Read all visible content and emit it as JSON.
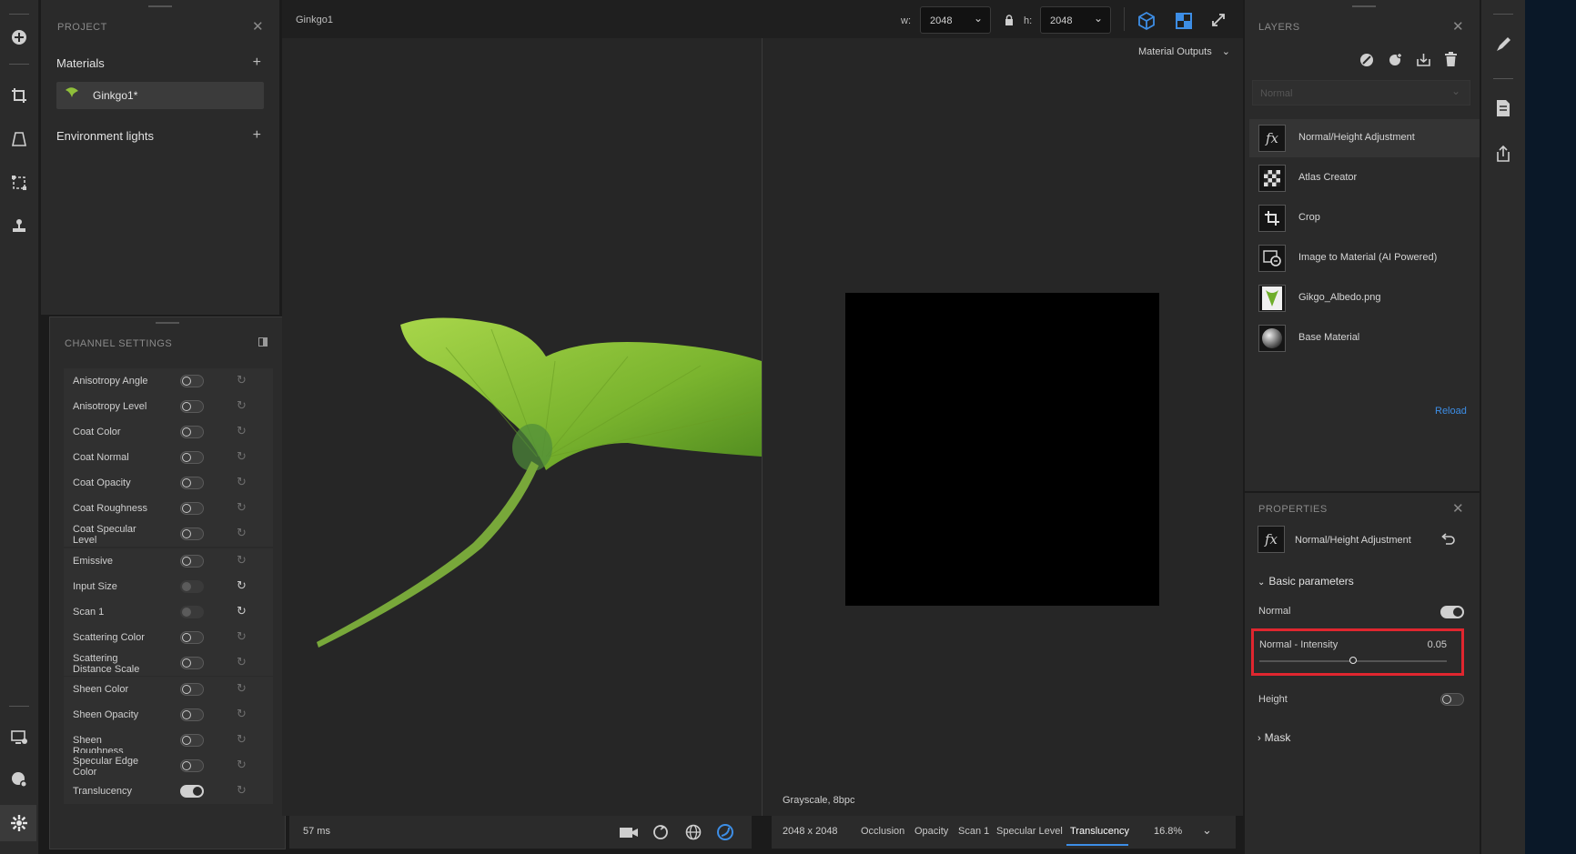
{
  "left_toolbar": {
    "icons": [
      "add-circle-icon",
      "crop-icon",
      "perspective-icon",
      "transform-icon",
      "stamp-icon",
      "display-settings-icon",
      "environment-settings-icon",
      "channel-settings-icon"
    ]
  },
  "project": {
    "title": "PROJECT",
    "materials_label": "Materials",
    "material_item": "Ginkgo1*",
    "env_lights_label": "Environment lights"
  },
  "channel_settings": {
    "title": "CHANNEL SETTINGS",
    "rows": [
      {
        "label": "Anisotropy Angle",
        "state": "off",
        "reset": "dim"
      },
      {
        "label": "Anisotropy Level",
        "state": "off",
        "reset": "dim"
      },
      {
        "label": "Coat Color",
        "state": "off",
        "reset": "dim"
      },
      {
        "label": "Coat Normal",
        "state": "off",
        "reset": "dim"
      },
      {
        "label": "Coat Opacity",
        "state": "off",
        "reset": "dim"
      },
      {
        "label": "Coat Roughness",
        "state": "off",
        "reset": "dim"
      },
      {
        "label": "Coat Specular Level",
        "state": "off",
        "reset": "dim"
      },
      {
        "label": "Emissive",
        "state": "off",
        "reset": "dim"
      },
      {
        "label": "Input Size",
        "state": "dim",
        "reset": "bright"
      },
      {
        "label": "Scan 1",
        "state": "dim",
        "reset": "bright"
      },
      {
        "label": "Scattering Color",
        "state": "off",
        "reset": "dim"
      },
      {
        "label": "Scattering Distance Scale",
        "state": "off",
        "reset": "dim"
      },
      {
        "label": "Sheen Color",
        "state": "off",
        "reset": "dim"
      },
      {
        "label": "Sheen Opacity",
        "state": "off",
        "reset": "dim"
      },
      {
        "label": "Sheen Roughness",
        "state": "off",
        "reset": "dim"
      },
      {
        "label": "Specular Edge Color",
        "state": "off",
        "reset": "dim"
      },
      {
        "label": "Translucency",
        "state": "on",
        "reset": "dim"
      }
    ]
  },
  "viewport": {
    "tab_title": "Ginkgo1",
    "w_label": "w:",
    "w_value": "2048",
    "h_label": "h:",
    "h_value": "2048",
    "outputs_dropdown": "Material Outputs",
    "render_time": "57 ms",
    "image_info": "Grayscale, 8bpc",
    "resolution": "2048 x 2048",
    "output_tabs": [
      "Occlusion",
      "Opacity",
      "Scan 1",
      "Specular Level",
      "Translucency"
    ],
    "active_output_tab": "Translucency",
    "zoom": "16.8%"
  },
  "layers": {
    "title": "LAYERS",
    "blend_mode": "Normal",
    "items": [
      {
        "name": "Normal/Height Adjustment",
        "icon": "fx-icon"
      },
      {
        "name": "Atlas Creator",
        "icon": "checker-icon"
      },
      {
        "name": "Crop",
        "icon": "crop-icon"
      },
      {
        "name": "Image to Material (AI Powered)",
        "icon": "ai-image-icon"
      },
      {
        "name": "Gikgo_Albedo.png",
        "icon": "image-thumb-icon"
      },
      {
        "name": "Base Material",
        "icon": "sphere-icon"
      }
    ],
    "reload_label": "Reload",
    "link_color": "#3d8ee6"
  },
  "properties": {
    "title": "PROPERTIES",
    "layer_name": "Normal/Height Adjustment",
    "section_basic": "Basic parameters",
    "normal_label": "Normal",
    "normal_on": true,
    "intensity_label": "Normal - Intensity",
    "intensity_value": "0.05",
    "intensity_fraction": 0.5,
    "height_label": "Height",
    "height_on": false,
    "section_mask": "Mask",
    "highlight_color": "#e0262f"
  },
  "right_toolbar": {
    "icons": [
      "brush-icon",
      "export-doc-icon",
      "share-icon"
    ]
  },
  "colors": {
    "accent": "#2d7fd3",
    "panel_bg": "#2a2a2a"
  }
}
